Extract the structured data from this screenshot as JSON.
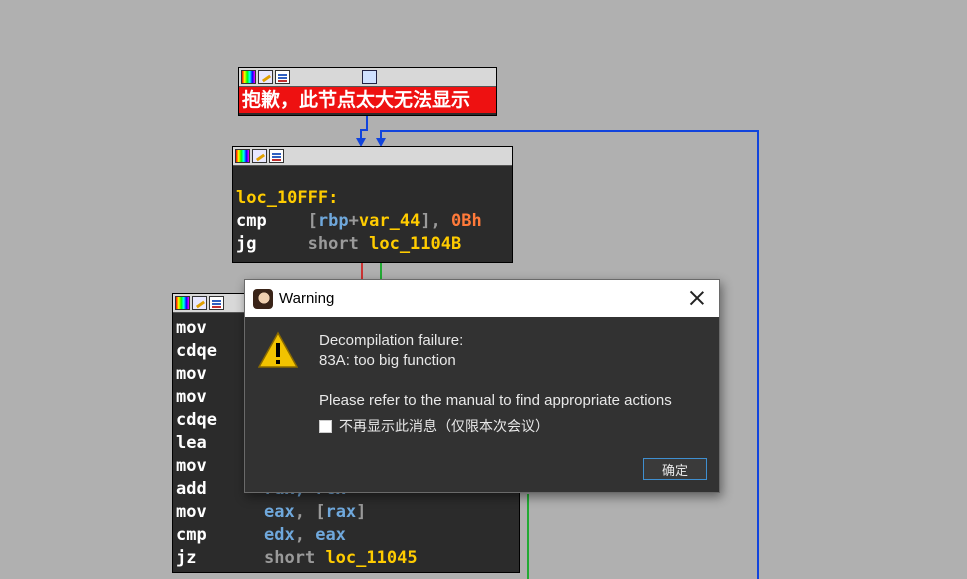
{
  "nodes": {
    "top": {
      "error_text": "抱歉，此节点太大无法显示"
    },
    "middle": {
      "label": "loc_10FFF:",
      "line1": {
        "mnemonic": "cmp",
        "open": "[",
        "reg": "rbp",
        "plus": "+",
        "var": "var_44",
        "close": "],",
        "imm": "0Bh"
      },
      "line2": {
        "mnemonic": "jg",
        "kw": "short",
        "target": "loc_1104B"
      }
    },
    "lower": {
      "mnemonics": [
        "mov",
        "cdqe",
        "mov",
        "mov",
        "cdqe",
        "lea",
        "mov",
        "add",
        "mov",
        "cmp",
        "jz"
      ],
      "partial_line": "rax, rcx",
      "line_mov": {
        "reg": "eax",
        "sep": ", ",
        "open": "[",
        "reg2": "rax",
        "close": "]"
      },
      "line_cmp": {
        "reg": "edx",
        "sep": ", ",
        "reg2": "eax"
      },
      "line_jz": {
        "kw": "short",
        "target": "loc_11045"
      }
    }
  },
  "dialog": {
    "title": "Warning",
    "line1": "Decompilation failure:",
    "line2": "83A: too big function",
    "line3": "Please refer to the manual to find appropriate actions",
    "checkbox_label": "不再显示此消息（仅限本次会议）",
    "checkbox_checked": false,
    "ok_label": "确定"
  },
  "colors": {
    "background": "#b0b0b0",
    "node_background": "#2b2b2b",
    "error_background": "#ee1111",
    "label_color": "#ffcc00",
    "register_color": "#6fa8dc",
    "immediate_color": "#ff7a3a",
    "edge_blue": "#1144dd",
    "edge_red": "#cc3333",
    "edge_green": "#22aa33",
    "dialog_background": "#323232"
  }
}
